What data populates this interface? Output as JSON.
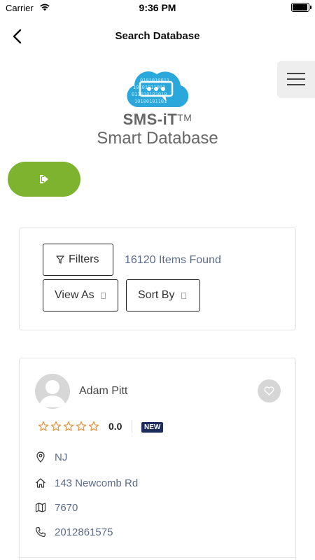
{
  "status_bar": {
    "carrier": "Carrier",
    "time": "9:36 PM"
  },
  "nav": {
    "title": "Search Database",
    "back_icon": "chevron-left-icon"
  },
  "menu": {
    "icon": "hamburger-icon"
  },
  "brand": {
    "name": "SMS-iT",
    "trademark": "TM",
    "subtitle": "Smart Database",
    "logo_text": "0101010011 1010101100 0110101010 1010010110"
  },
  "action_button": {
    "icon": "sign-out-icon",
    "color": "#7db32e"
  },
  "filters": {
    "filters_label": "Filters",
    "items_found": "16120 Items Found",
    "view_as_label": "View As",
    "sort_by_label": "Sort By"
  },
  "record": {
    "name": "Adam Pitt",
    "rating": "0.0",
    "stars_filled": 0,
    "stars_total": 5,
    "badge": "NEW",
    "state": "NJ",
    "address": "143 Newcomb Rd",
    "zip": "7670",
    "phone": "2012861575"
  },
  "colors": {
    "accent_green": "#7db32e",
    "link_text": "#5b6b8a",
    "star_orange": "#e38a2e",
    "badge_navy": "#1d2a5c",
    "logo_blue": "#2aa8dc"
  }
}
